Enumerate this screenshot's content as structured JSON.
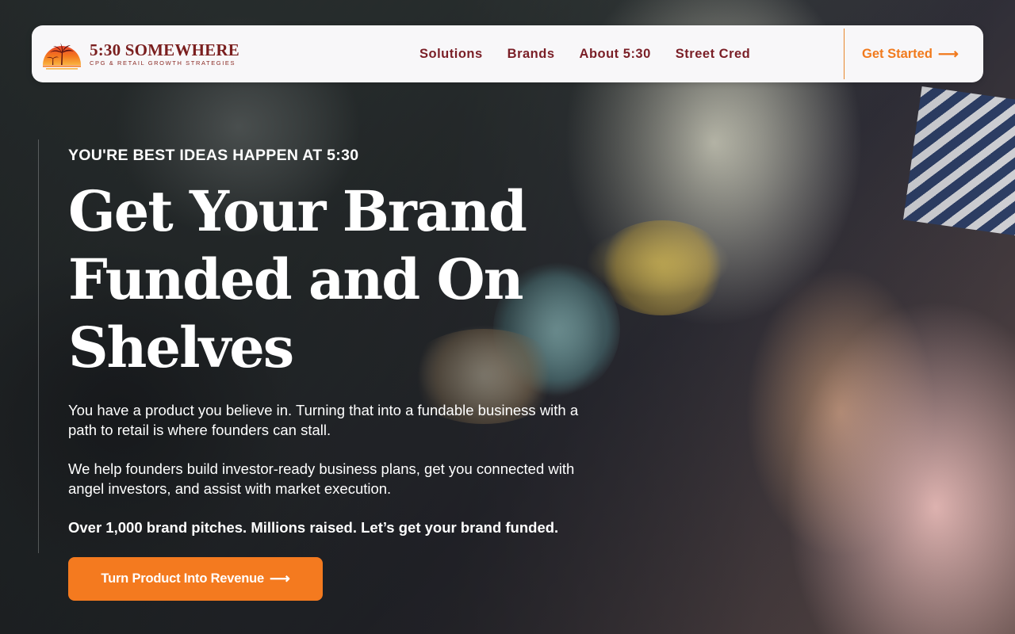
{
  "brand": {
    "name": "5:30 SOMEWHERE",
    "tagline": "CPG & RETAIL GROWTH STRATEGIES",
    "logo_icon": "sunset-palm-icon",
    "colors": {
      "primary": "#7a1e26",
      "accent": "#f47a1f",
      "navbar_bg": "#f8f7f9"
    }
  },
  "nav": {
    "items": [
      {
        "label": "Solutions"
      },
      {
        "label": "Brands"
      },
      {
        "label": "About 5:30"
      },
      {
        "label": "Street Cred"
      }
    ],
    "cta_label": "Get Started",
    "cta_icon": "arrow-right-icon",
    "cta_arrow": "⟶"
  },
  "hero": {
    "eyebrow": "YOU'RE BEST IDEAS HAPPEN AT 5:30",
    "headline": "Get Your Brand Funded and On Shelves",
    "paragraph_1": "You have a product you believe in. Turning that into a fundable business with a path to retail is where founders can stall.",
    "paragraph_2": "We help founders build investor-ready business plans, get you connected with angel investors, and assist with market execution.",
    "paragraph_3": "Over 1,000 brand pitches. Millions raised. Let’s get your brand funded.",
    "cta_label": "Turn Product Into Revenue",
    "cta_arrow": "⟶"
  }
}
